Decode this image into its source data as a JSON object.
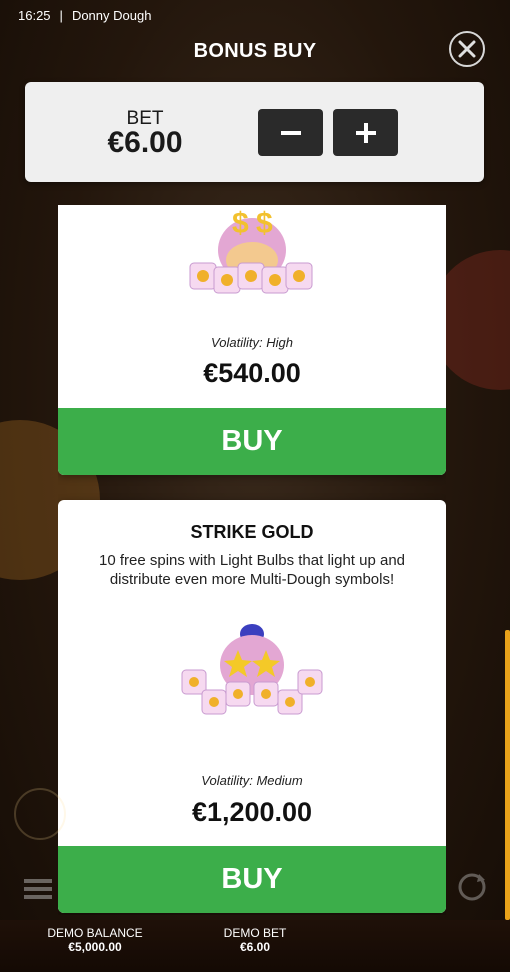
{
  "status": {
    "time": "16:25",
    "separator": "|",
    "game": "Donny Dough"
  },
  "header": {
    "title": "BONUS BUY",
    "close_icon": "close-icon"
  },
  "bet": {
    "label": "BET",
    "value": "€6.00",
    "minus_icon": "minus-icon",
    "plus_icon": "plus-icon"
  },
  "cards": [
    {
      "volatility": "Volatility: High",
      "price": "€540.00",
      "buy_label": "BUY"
    },
    {
      "title": "STRIKE GOLD",
      "description": "10 free spins with Light Bulbs that light up and distribute even more Multi-Dough symbols!",
      "volatility": "Volatility: Medium",
      "price": "€1,200.00",
      "buy_label": "BUY"
    }
  ],
  "footer": {
    "balance_label": "DEMO BALANCE",
    "balance_value": "€5,000.00",
    "bet_label": "DEMO BET",
    "bet_value": "€6.00"
  },
  "colors": {
    "buy_green": "#3cae4a",
    "bet_panel": "#efefef",
    "scrollbar": "#e8a21a"
  }
}
